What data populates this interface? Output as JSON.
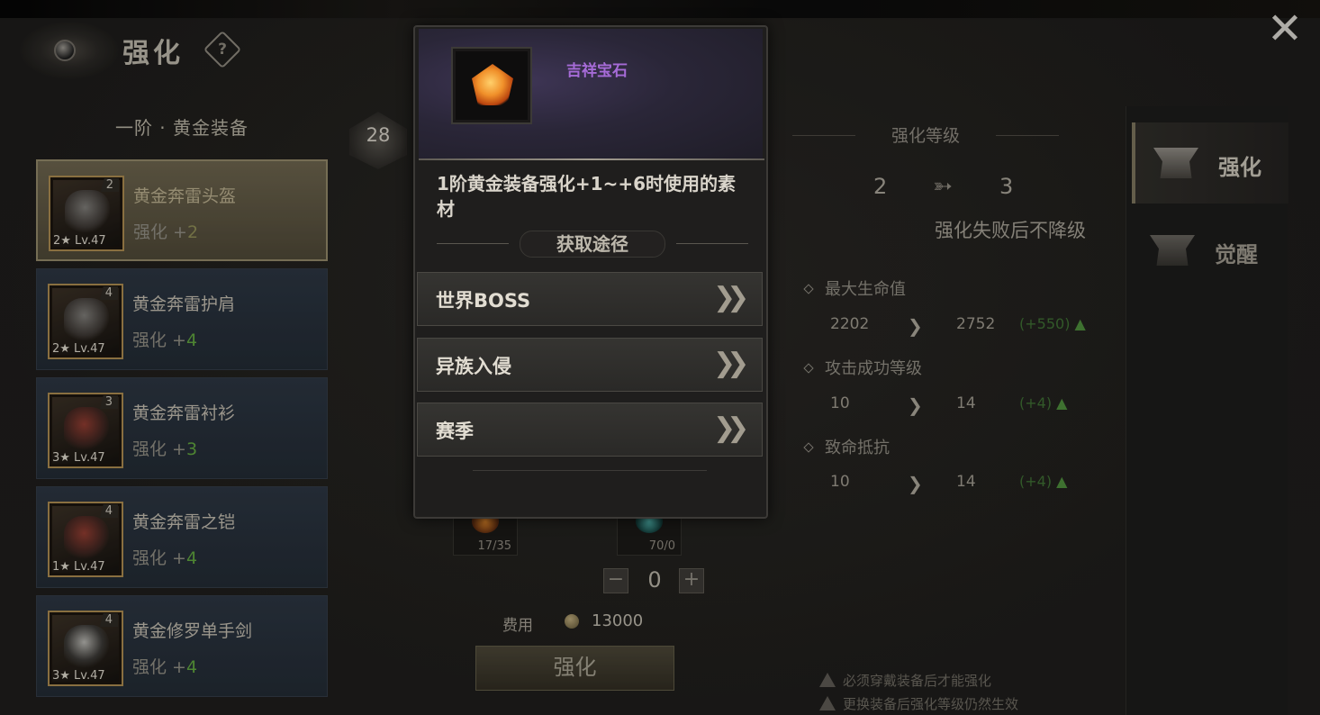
{
  "header": {
    "title": "强化",
    "help": "?"
  },
  "list": {
    "title": "一阶 · 黄金装备",
    "items": [
      {
        "name": "黄金奔雷头盔",
        "enh_prefix": "强化 +",
        "enh_value": "2",
        "count": "2",
        "lv": "2★ Lv.47",
        "art": "helmet-icon"
      },
      {
        "name": "黄金奔雷护肩",
        "enh_prefix": "强化 +",
        "enh_value": "4",
        "count": "4",
        "lv": "2★ Lv.47",
        "art": "shoulder-icon"
      },
      {
        "name": "黄金奔雷衬衫",
        "enh_prefix": "强化 +",
        "enh_value": "3",
        "count": "3",
        "lv": "3★ Lv.47",
        "art": "shirt-icon"
      },
      {
        "name": "黄金奔雷之铠",
        "enh_prefix": "强化 +",
        "enh_value": "4",
        "count": "4",
        "lv": "1★ Lv.47",
        "art": "armor-icon"
      },
      {
        "name": "黄金修罗单手剑",
        "enh_prefix": "强化 +",
        "enh_value": "4",
        "count": "4",
        "lv": "3★ Lv.47",
        "art": "sword-icon"
      }
    ]
  },
  "middle": {
    "level_badge": "28",
    "materials": [
      {
        "count": "17/35"
      },
      {
        "count": "70/0"
      }
    ],
    "stepper": {
      "minus": "−",
      "value": "0",
      "plus": "+"
    },
    "cost_label": "费用",
    "cost_value": "13000",
    "enhance_button": "强化"
  },
  "stats": {
    "level_title": "强化等级",
    "level_from": "2",
    "level_to": "3",
    "no_drop": "强化失败后不降级",
    "rows": [
      {
        "label": "最大生命值",
        "from": "2202",
        "to": "2752",
        "diff": "(+550)"
      },
      {
        "label": "攻击成功等级",
        "from": "10",
        "to": "14",
        "diff": "(+4)"
      },
      {
        "label": "致命抵抗",
        "from": "10",
        "to": "14",
        "diff": "(+4)"
      }
    ],
    "notes": [
      "必须穿戴装备后才能强化",
      "更换装备后强化等级仍然生效"
    ]
  },
  "tabs": [
    {
      "label": "强化"
    },
    {
      "label": "觉醒"
    }
  ],
  "modal": {
    "item_name": "吉祥宝石",
    "description": "1阶黄金装备强化+1~+6时使用的素材",
    "source_title": "获取途径",
    "sources": [
      {
        "label": "世界BOSS"
      },
      {
        "label": "异族入侵"
      },
      {
        "label": "赛季"
      }
    ]
  },
  "colors": {
    "accent_green": "#5fa23d",
    "item_title_purple": "#a66bd7"
  }
}
